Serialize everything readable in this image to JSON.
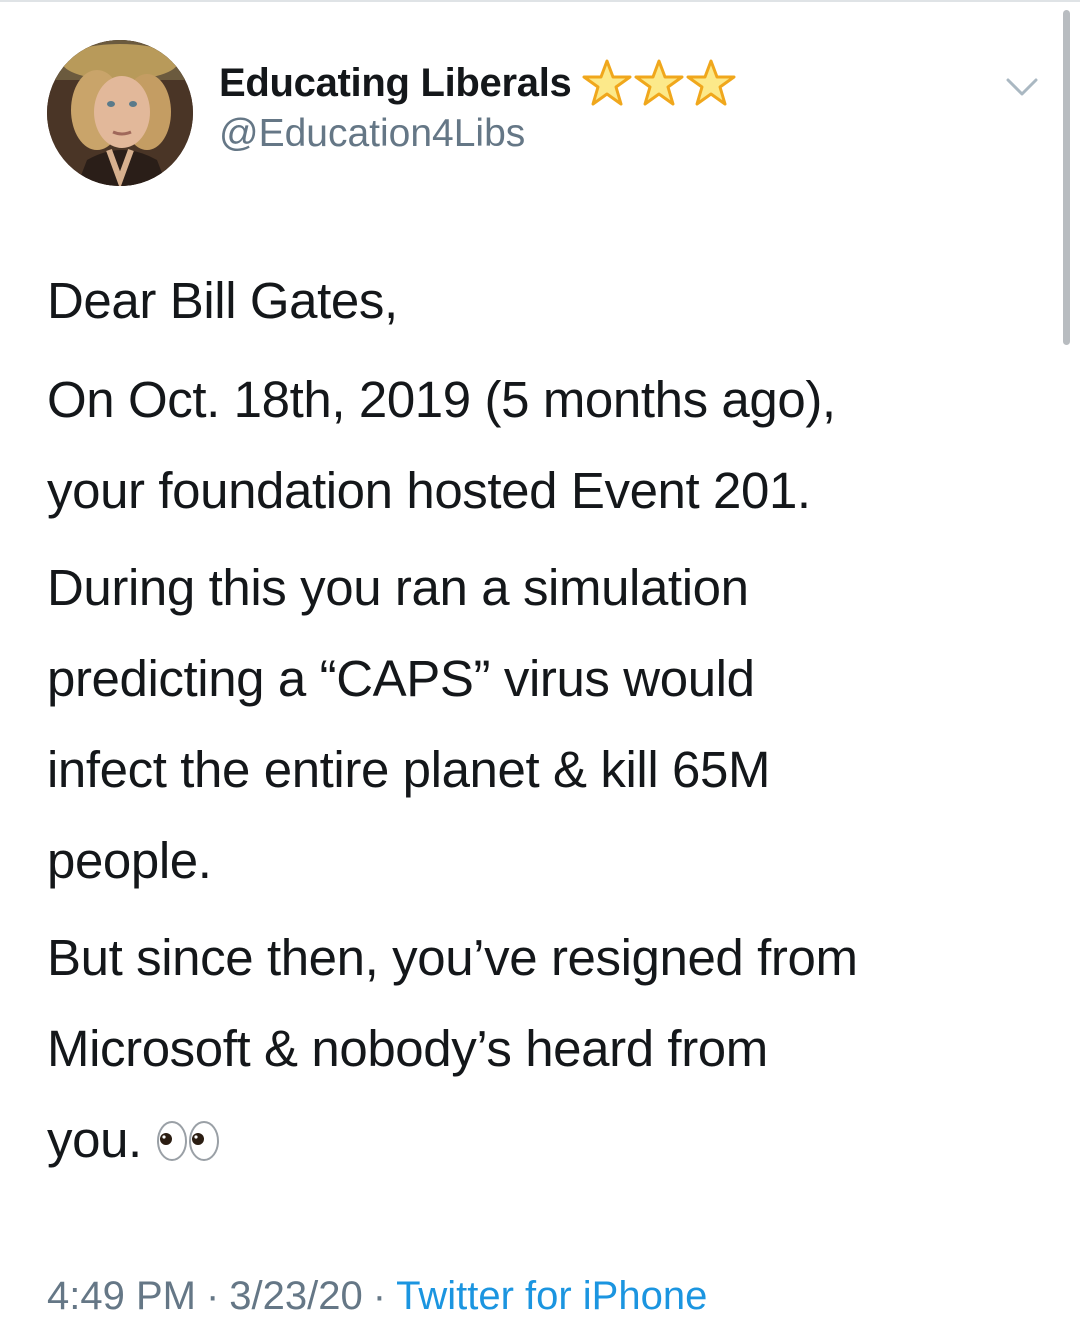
{
  "tweet": {
    "author": {
      "display_name": "Educating Liberals",
      "handle": "@Education4Libs",
      "badge_emoji": "star-icon x3",
      "avatar": "avatar-photo"
    },
    "menu_icon": "chevron-down-icon",
    "paragraphs": [
      "Dear Bill Gates,",
      "On Oct. 18th, 2019 (5 months ago), your foundation hosted Event 201.",
      "During this you ran a simulation predicting a “CAPS” virus would infect the entire planet & kill 65M people.",
      "But since then, you’ve resigned from Microsoft & nobody’s heard from you."
    ],
    "lines": {
      "p1": [
        "Dear Bill Gates,"
      ],
      "p2": [
        "On Oct. 18th, 2019 (5 months ago),",
        "your foundation hosted Event 201."
      ],
      "p3": [
        "During this you ran a simulation",
        "predicting a “CAPS” virus would",
        "infect the entire planet & kill 65M",
        "people."
      ],
      "p4": [
        "But since then, you’ve resigned from",
        "Microsoft & nobody’s heard from",
        "you."
      ]
    },
    "trailing_emoji": "eyes-icon",
    "meta": {
      "time": "4:49 PM",
      "separator": "·",
      "date": "3/23/20",
      "source": "Twitter for iPhone"
    }
  },
  "colors": {
    "text": "#14171a",
    "secondary": "#657786",
    "link": "#1b95e0",
    "star": "#f5c518"
  }
}
